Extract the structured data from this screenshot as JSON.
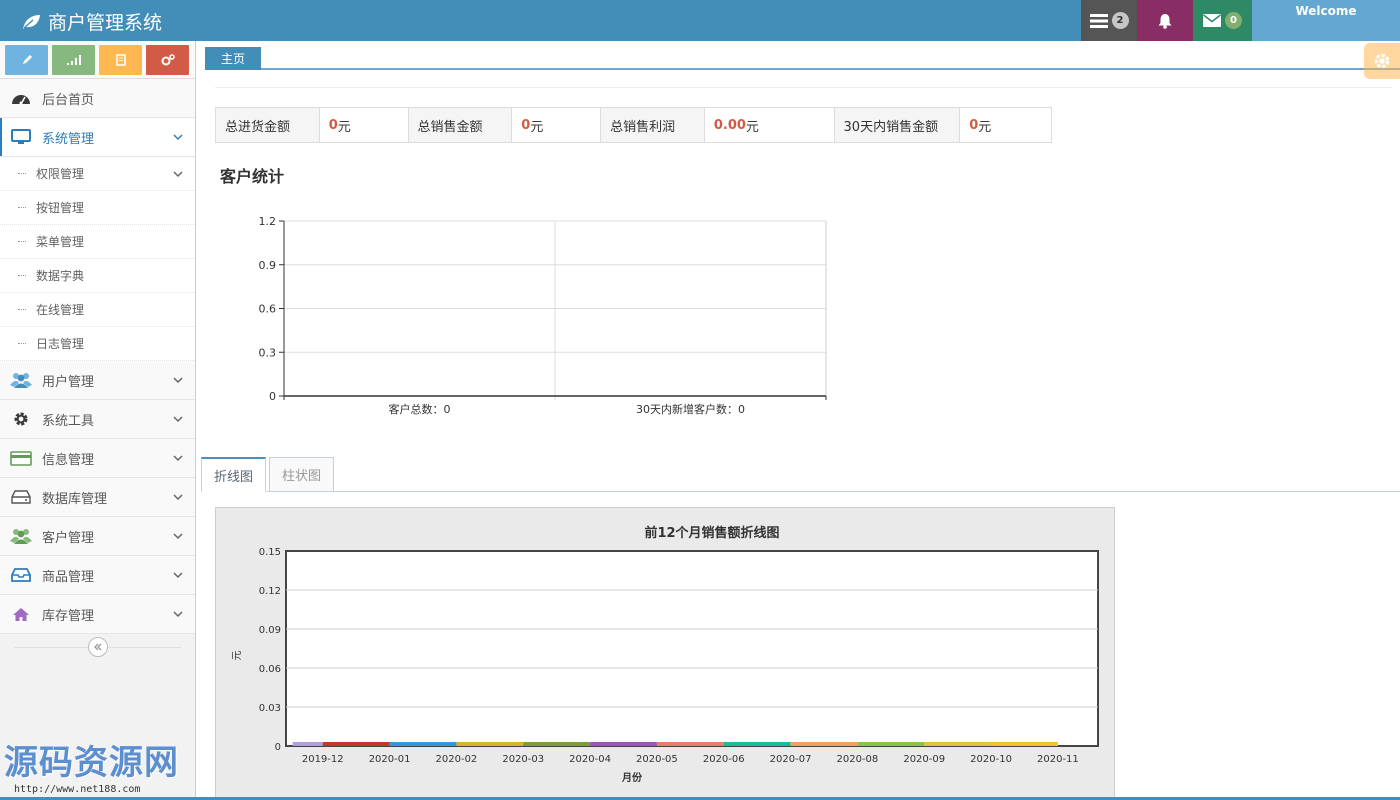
{
  "header": {
    "brand": "商户管理系统",
    "tasks_count": "2",
    "messages_count": "0",
    "user_label": "Welcome"
  },
  "sidebar": {
    "items": [
      {
        "label": "后台首页",
        "icon": "dashboard-icon"
      },
      {
        "label": "系统管理",
        "icon": "desktop-icon",
        "active": true
      },
      {
        "label": "用户管理",
        "icon": "users-icon"
      },
      {
        "label": "系统工具",
        "icon": "gear-icon"
      },
      {
        "label": "信息管理",
        "icon": "credit-card-icon"
      },
      {
        "label": "数据库管理",
        "icon": "hdd-icon"
      },
      {
        "label": "客户管理",
        "icon": "group-icon"
      },
      {
        "label": "商品管理",
        "icon": "inbox-icon"
      },
      {
        "label": "库存管理",
        "icon": "home-icon"
      }
    ],
    "sub_items": [
      "权限管理",
      "按钮管理",
      "菜单管理",
      "数据字典",
      "在线管理",
      "日志管理"
    ]
  },
  "main": {
    "home_tab": "主页",
    "stats": {
      "purchase_label": "总进货金额",
      "purchase_value": "0",
      "purchase_unit": "元",
      "sales_label": "总销售金额",
      "sales_value": "0",
      "sales_unit": "元",
      "profit_label": "总销售利润",
      "profit_value": "0.00",
      "profit_unit": "元",
      "sales30_label": "30天内销售金额",
      "sales30_value": "0",
      "sales30_unit": "元"
    },
    "customer_title": "客户统计",
    "chart_tabs": [
      "折线图",
      "柱状图"
    ]
  },
  "colors": {
    "brand": "#438eb9",
    "accent_red": "#d15b47"
  },
  "watermark": {
    "text": "源码资源网",
    "url": "http://www.net188.com"
  },
  "chart_data": [
    {
      "type": "bar",
      "categories": [
        "客户总数：0",
        "30天内新增客户数：0"
      ],
      "values": [
        0,
        0
      ],
      "title": "",
      "xlabel": "",
      "ylabel": "",
      "ylim": [
        0,
        1.2
      ],
      "yticks": [
        "0",
        "0.3",
        "0.6",
        "0.9",
        "1.2"
      ],
      "grid": true
    },
    {
      "type": "line",
      "title": "前12个月销售额折线图",
      "xlabel": "月份",
      "ylabel": "元",
      "categories": [
        "2019-12",
        "2020-01",
        "2020-02",
        "2020-03",
        "2020-04",
        "2020-05",
        "2020-06",
        "2020-07",
        "2020-08",
        "2020-09",
        "2020-10",
        "2020-11"
      ],
      "values": [
        0,
        0,
        0,
        0,
        0,
        0,
        0,
        0,
        0,
        0,
        0,
        0
      ],
      "ylim": [
        0,
        0.15
      ],
      "yticks": [
        "0",
        "0.03",
        "0.06",
        "0.09",
        "0.12",
        "0.15"
      ],
      "segment_colors": [
        "#b39ddb",
        "#c0392b",
        "#3498db",
        "#d4b52b",
        "#7f9c3a",
        "#9b59b6",
        "#e67e6e",
        "#1abc9c",
        "#f0a35e",
        "#8bc34a",
        "#e0c341",
        "#f1c232"
      ],
      "grid": true
    }
  ]
}
